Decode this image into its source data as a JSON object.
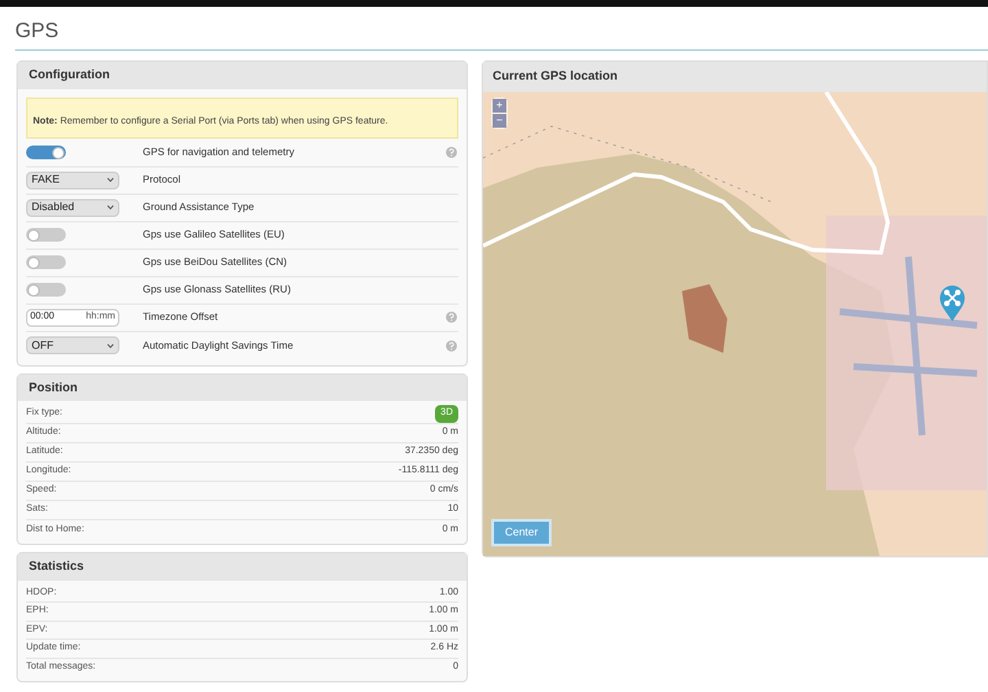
{
  "page_title": "GPS",
  "configuration": {
    "title": "Configuration",
    "note_label": "Note:",
    "note_text": "Remember to configure a Serial Port (via Ports tab) when using GPS feature.",
    "items": [
      {
        "kind": "toggle",
        "on": true,
        "label": "GPS for navigation and telemetry",
        "help": true
      },
      {
        "kind": "select",
        "value": "FAKE",
        "label": "Protocol",
        "help": false
      },
      {
        "kind": "select",
        "value": "Disabled",
        "label": "Ground Assistance Type",
        "help": false
      },
      {
        "kind": "toggle",
        "on": false,
        "label": "Gps use Galileo Satellites (EU)",
        "help": false
      },
      {
        "kind": "toggle",
        "on": false,
        "label": "Gps use BeiDou Satellites (CN)",
        "help": false
      },
      {
        "kind": "toggle",
        "on": false,
        "label": "Gps use Glonass Satellites (RU)",
        "help": false
      },
      {
        "kind": "time",
        "value": "00:00",
        "suffix": "hh:mm",
        "label": "Timezone Offset",
        "help": true
      },
      {
        "kind": "select",
        "value": "OFF",
        "label": "Automatic Daylight Savings Time",
        "help": true
      }
    ]
  },
  "position": {
    "title": "Position",
    "rows": [
      {
        "label": "Fix type:",
        "value": "3D",
        "kind": "badge"
      },
      {
        "label": "Altitude:",
        "value": "0 m",
        "kind": "text"
      },
      {
        "label": "Latitude:",
        "value": "37.2350 deg",
        "kind": "text"
      },
      {
        "label": "Longitude:",
        "value": "-115.8111 deg",
        "kind": "text"
      },
      {
        "label": "Speed:",
        "value": "0 cm/s",
        "kind": "text"
      },
      {
        "label": "Sats:",
        "value": "10",
        "kind": "text"
      },
      {
        "label": "Dist to Home:",
        "value": "0 m",
        "kind": "text"
      }
    ]
  },
  "statistics": {
    "title": "Statistics",
    "rows": [
      {
        "label": "HDOP:",
        "value": "1.00"
      },
      {
        "label": "EPH:",
        "value": "1.00 m"
      },
      {
        "label": "EPV:",
        "value": "1.00 m"
      },
      {
        "label": "Update time:",
        "value": "2.6 Hz"
      },
      {
        "label": "Total messages:",
        "value": "0"
      }
    ]
  },
  "map": {
    "title": "Current GPS location",
    "zoom_in": "+",
    "zoom_out": "−",
    "center_button": "Center"
  }
}
